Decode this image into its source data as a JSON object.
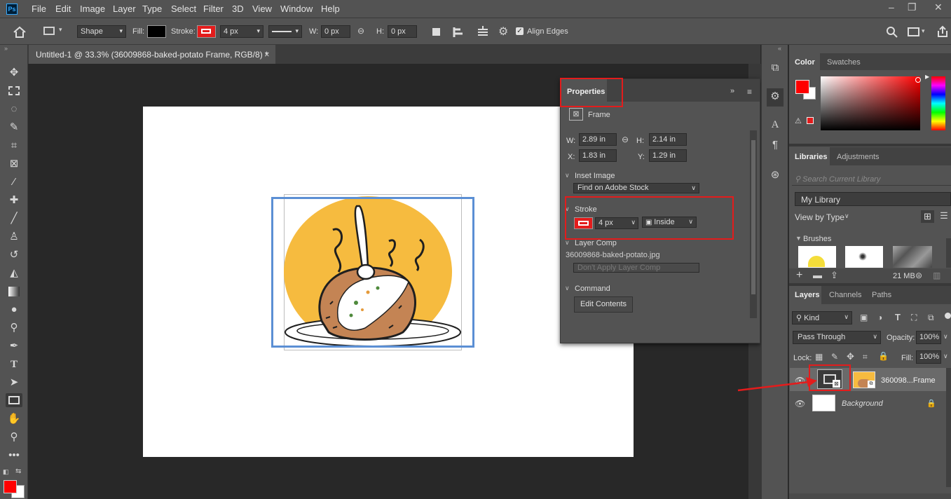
{
  "app": {
    "logo": "Ps"
  },
  "menu": [
    "File",
    "Edit",
    "Image",
    "Layer",
    "Type",
    "Select",
    "Filter",
    "3D",
    "View",
    "Window",
    "Help"
  ],
  "window_controls": [
    "–",
    "❐",
    "✕"
  ],
  "options": {
    "mode": "Shape",
    "fill_label": "Fill:",
    "stroke_label": "Stroke:",
    "stroke_width": "4 px",
    "w_label": "W:",
    "w_value": "0 px",
    "h_label": "H:",
    "h_value": "0 px",
    "align_edges": "Align Edges",
    "fill_color": "#000000",
    "stroke_color": "#e31c1c"
  },
  "document_tab": {
    "title": "Untitled-1 @ 33.3% (36009868-baked-potato Frame, RGB/8) *",
    "close": "×"
  },
  "tools": [
    "move-icon",
    "marquee-icon",
    "lasso-icon",
    "quick-select-icon",
    "crop-icon",
    "frame-icon",
    "eyedropper-icon",
    "healing-icon",
    "brush-icon",
    "stamp-icon",
    "history-brush-icon",
    "eraser-icon",
    "gradient-icon",
    "blur-icon",
    "dodge-icon",
    "pen-icon",
    "type-icon",
    "path-select-icon",
    "rectangle-icon",
    "hand-icon",
    "zoom-icon",
    "more-icon"
  ],
  "colors": {
    "foreground": "#ff0000",
    "background": "#ffffff",
    "accent_red": "#e31c1c",
    "frame_blue": "#5b8fd4"
  },
  "properties": {
    "tab": "Properties",
    "type": "Frame",
    "w_label": "W:",
    "w": "2.89 in",
    "h_label": "H:",
    "h": "2.14 in",
    "x_label": "X:",
    "x": "1.83 in",
    "y_label": "Y:",
    "y": "1.29 in",
    "inset_section": "Inset Image",
    "inset_value": "Find on Adobe Stock",
    "stroke_section": "Stroke",
    "stroke_width": "4 px",
    "stroke_align": "Inside",
    "layer_comp_section": "Layer Comp",
    "layer_comp_file": "36009868-baked-potato.jpg",
    "layer_comp_value": "Don't Apply Layer Comp",
    "command_section": "Command",
    "edit_contents": "Edit Contents"
  },
  "color_panel": {
    "tabs": [
      "Color",
      "Swatches"
    ]
  },
  "libraries": {
    "tabs": [
      "Libraries",
      "Adjustments"
    ],
    "search_placeholder": "Search Current Library",
    "library": "My Library",
    "view_by": "View by Type",
    "brushes": "Brushes",
    "size": "21 MB"
  },
  "layers": {
    "tabs": [
      "Layers",
      "Channels",
      "Paths"
    ],
    "kind": "Kind",
    "blend": "Pass Through",
    "opacity_label": "Opacity:",
    "opacity": "100%",
    "lock_label": "Lock:",
    "fill_label": "Fill:",
    "fill": "100%",
    "rows": [
      {
        "name": "360098...Frame"
      },
      {
        "name": "Background"
      }
    ]
  }
}
